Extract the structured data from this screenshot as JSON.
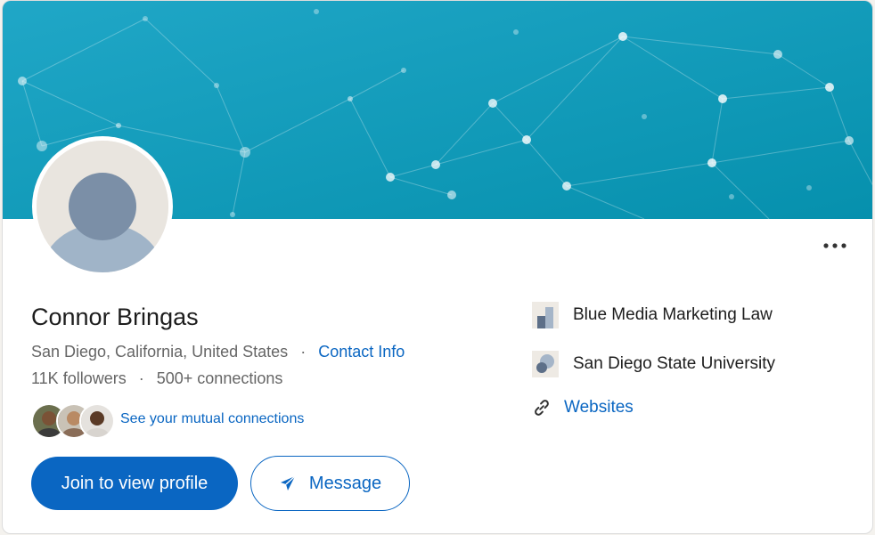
{
  "profile": {
    "name": "Connor Bringas",
    "location": "San Diego, California, United States",
    "contact_info": "Contact Info",
    "followers": "11K followers",
    "connections": "500+ connections",
    "mutual_link": "See your mutual connections",
    "separator": "·"
  },
  "actions": {
    "join_label": "Join to view profile",
    "message_label": "Message",
    "more_label": "···"
  },
  "sidebar": {
    "company": "Blue Media Marketing Law",
    "school": "San Diego State University",
    "websites": "Websites"
  },
  "colors": {
    "accent": "#0a66c2",
    "banner_start": "#1aa3c4",
    "banner_end": "#0893b3"
  },
  "icons": {
    "more": "more-horizontal-icon",
    "send": "send-icon",
    "link": "link-icon",
    "company": "company-logo-icon",
    "school": "school-logo-icon"
  }
}
